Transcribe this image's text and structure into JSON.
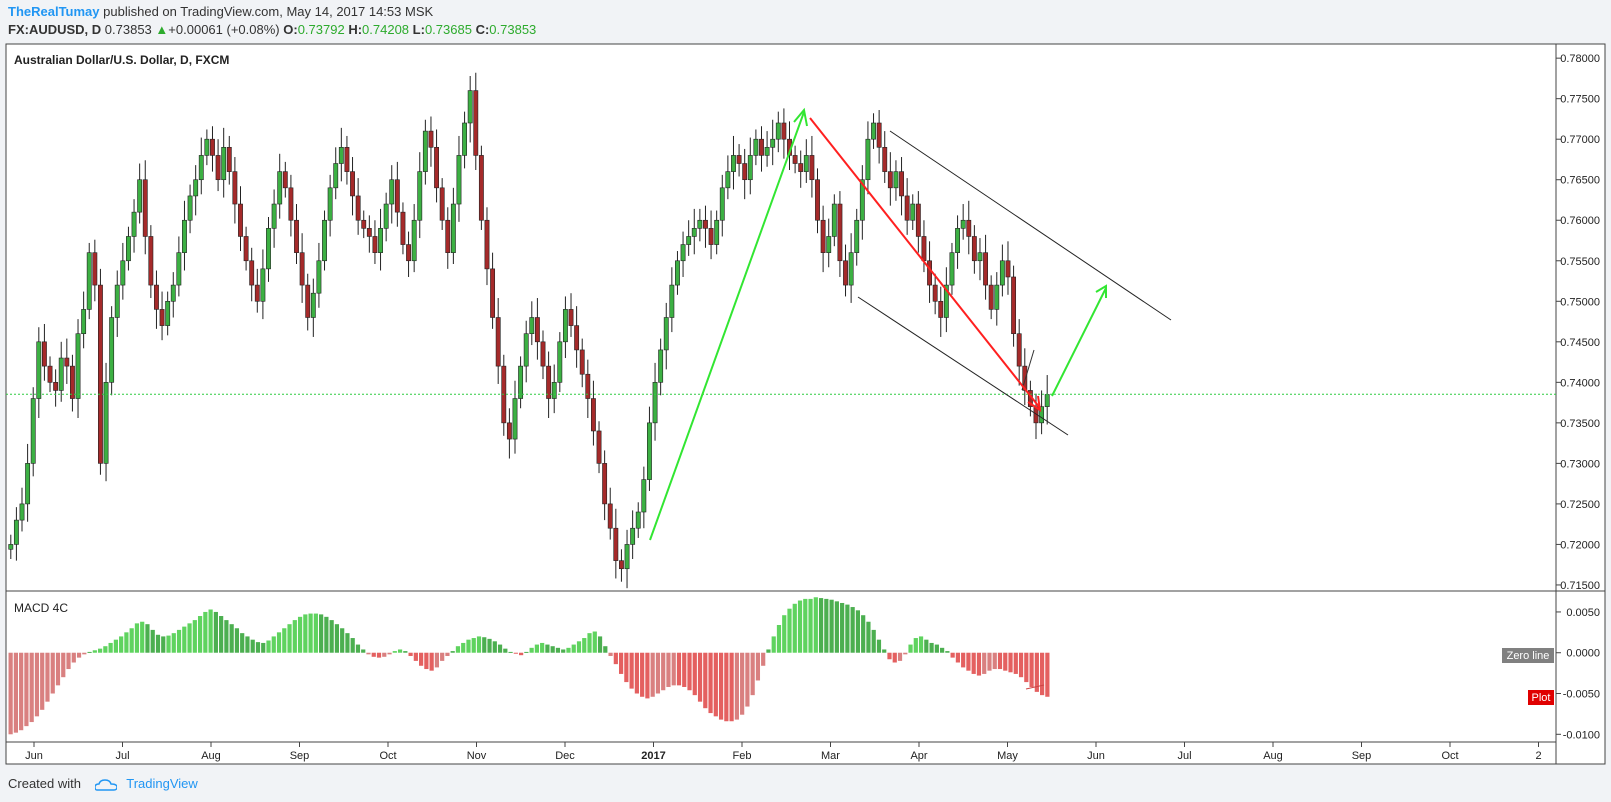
{
  "header": {
    "user": "TheRealTumay",
    "published": "published on TradingView.com, May 14, 2017 14:53 MSK",
    "symbol": "FX:AUDUSD, D",
    "last": "0.73853",
    "change": "+0.00061 (+0.08%)",
    "o_label": "O:",
    "o": "0.73792",
    "h_label": "H:",
    "h": "0.74208",
    "l_label": "L:",
    "l": "0.73685",
    "c_label": "C:",
    "c": "0.73853"
  },
  "footer": {
    "created_with": "Created with",
    "brand": "TradingView"
  },
  "colors": {
    "up": "#3cb043",
    "down": "#a52a2a",
    "macd_pos": "#5fd35f",
    "macd_neg": "#e46060",
    "price_line": "#2ecc40"
  },
  "chart_data": [
    {
      "type": "candlestick",
      "title": "Australian Dollar/U.S. Dollar, D, FXCM",
      "ylim": [
        0.7145,
        0.7815
      ],
      "y_ticks": [
        "0.78000",
        "0.77500",
        "0.77000",
        "0.76500",
        "0.76000",
        "0.75500",
        "0.75000",
        "0.74500",
        "0.74000",
        "0.73500",
        "0.73000",
        "0.72500",
        "0.72000",
        "0.71500"
      ],
      "x_ticks": [
        "Jun",
        "Jul",
        "Aug",
        "Sep",
        "Oct",
        "Nov",
        "Dec",
        "2017",
        "Feb",
        "Mar",
        "Apr",
        "May",
        "Jun",
        "Jul",
        "Aug",
        "Sep",
        "Oct",
        "2"
      ],
      "current_price": 0.73853,
      "closes": [
        0.72,
        0.723,
        0.725,
        0.73,
        0.738,
        0.745,
        0.742,
        0.74,
        0.739,
        0.743,
        0.742,
        0.738,
        0.746,
        0.749,
        0.756,
        0.752,
        0.73,
        0.74,
        0.748,
        0.752,
        0.755,
        0.758,
        0.761,
        0.765,
        0.758,
        0.752,
        0.749,
        0.747,
        0.75,
        0.752,
        0.756,
        0.76,
        0.763,
        0.765,
        0.768,
        0.77,
        0.768,
        0.765,
        0.769,
        0.766,
        0.762,
        0.758,
        0.755,
        0.752,
        0.75,
        0.754,
        0.759,
        0.762,
        0.766,
        0.764,
        0.76,
        0.756,
        0.752,
        0.748,
        0.751,
        0.755,
        0.76,
        0.764,
        0.767,
        0.769,
        0.766,
        0.763,
        0.76,
        0.759,
        0.758,
        0.756,
        0.759,
        0.762,
        0.765,
        0.761,
        0.757,
        0.755,
        0.76,
        0.766,
        0.771,
        0.769,
        0.764,
        0.76,
        0.756,
        0.762,
        0.768,
        0.772,
        0.776,
        0.768,
        0.76,
        0.754,
        0.748,
        0.742,
        0.735,
        0.733,
        0.738,
        0.742,
        0.746,
        0.748,
        0.745,
        0.742,
        0.738,
        0.74,
        0.745,
        0.749,
        0.747,
        0.744,
        0.741,
        0.738,
        0.734,
        0.73,
        0.725,
        0.722,
        0.718,
        0.717,
        0.72,
        0.722,
        0.724,
        0.728,
        0.735,
        0.74,
        0.744,
        0.748,
        0.752,
        0.755,
        0.757,
        0.758,
        0.759,
        0.76,
        0.759,
        0.757,
        0.76,
        0.764,
        0.766,
        0.768,
        0.767,
        0.765,
        0.768,
        0.77,
        0.768,
        0.769,
        0.77,
        0.772,
        0.77,
        0.768,
        0.767,
        0.766,
        0.768,
        0.765,
        0.76,
        0.756,
        0.758,
        0.762,
        0.755,
        0.752,
        0.756,
        0.76,
        0.765,
        0.77,
        0.772,
        0.769,
        0.766,
        0.764,
        0.766,
        0.763,
        0.76,
        0.762,
        0.758,
        0.755,
        0.752,
        0.75,
        0.748,
        0.752,
        0.756,
        0.759,
        0.76,
        0.758,
        0.755,
        0.756,
        0.752,
        0.749,
        0.752,
        0.755,
        0.753,
        0.746,
        0.742,
        0.739,
        0.737,
        0.735,
        0.737,
        0.7385
      ]
    },
    {
      "type": "bar",
      "title": "MACD 4C",
      "ylim": [
        -0.0107,
        0.0072
      ],
      "y_ticks": [
        "0.0050",
        "0.0000",
        "-0.0050",
        "-0.0100"
      ],
      "badges": {
        "zero": "Zero line",
        "plot": "Plot"
      },
      "values": [
        -0.01,
        -0.0098,
        -0.0095,
        -0.009,
        -0.0085,
        -0.0078,
        -0.007,
        -0.006,
        -0.005,
        -0.004,
        -0.003,
        -0.002,
        -0.0012,
        -0.0006,
        -0.0002,
        0.0001,
        0.0003,
        0.0005,
        0.0008,
        0.0012,
        0.0016,
        0.002,
        0.0025,
        0.003,
        0.0036,
        0.0038,
        0.0035,
        0.0028,
        0.0022,
        0.002,
        0.0021,
        0.0024,
        0.0028,
        0.0032,
        0.0036,
        0.004,
        0.0045,
        0.005,
        0.0053,
        0.005,
        0.0045,
        0.004,
        0.0035,
        0.003,
        0.0024,
        0.002,
        0.0016,
        0.0013,
        0.0012,
        0.0015,
        0.002,
        0.0025,
        0.003,
        0.0035,
        0.004,
        0.0044,
        0.0047,
        0.0048,
        0.0048,
        0.0047,
        0.0044,
        0.004,
        0.0035,
        0.003,
        0.0024,
        0.0018,
        0.001,
        0.0004,
        -0.0002,
        -0.0005,
        -0.0006,
        -0.0005,
        -0.0002,
        0.0002,
        0.0004,
        0.0002,
        -0.0004,
        -0.001,
        -0.0016,
        -0.002,
        -0.0022,
        -0.0018,
        -0.001,
        -0.0004,
        0.0002,
        0.0008,
        0.0012,
        0.0016,
        0.0018,
        0.002,
        0.0019,
        0.0017,
        0.0014,
        0.001,
        0.0005,
        0.0001,
        -0.0001,
        -0.0003,
        0.0001,
        0.0006,
        0.001,
        0.0012,
        0.001,
        0.0008,
        0.0006,
        0.0004,
        0.0006,
        0.001,
        0.0014,
        0.0018,
        0.0024,
        0.0026,
        0.002,
        0.0008,
        -0.0004,
        -0.0014,
        -0.0026,
        -0.0036,
        -0.0044,
        -0.005,
        -0.0054,
        -0.0056,
        -0.0054,
        -0.005,
        -0.0046,
        -0.0042,
        -0.004,
        -0.004,
        -0.0042,
        -0.0046,
        -0.0052,
        -0.006,
        -0.0068,
        -0.0074,
        -0.0078,
        -0.0082,
        -0.0084,
        -0.0084,
        -0.0082,
        -0.0076,
        -0.0066,
        -0.0052,
        -0.0034,
        -0.0016,
        0.0004,
        0.002,
        0.0034,
        0.0046,
        0.0054,
        0.006,
        0.0064,
        0.0066,
        0.0066,
        0.0068,
        0.0067,
        0.0066,
        0.0065,
        0.0063,
        0.0061,
        0.0059,
        0.0056,
        0.0052,
        0.0046,
        0.0038,
        0.0028,
        0.0016,
        0.0004,
        -0.0008,
        -0.0012,
        -0.001,
        -0.0002,
        0.001,
        0.0018,
        0.002,
        0.0016,
        0.0012,
        0.001,
        0.0006,
        0.0002,
        -0.0006,
        -0.0012,
        -0.0018,
        -0.0022,
        -0.0026,
        -0.0028,
        -0.0026,
        -0.0022,
        -0.002,
        -0.002,
        -0.0022,
        -0.0024,
        -0.0026,
        -0.003,
        -0.0036,
        -0.0042,
        -0.0048,
        -0.0052,
        -0.0054
      ]
    }
  ]
}
